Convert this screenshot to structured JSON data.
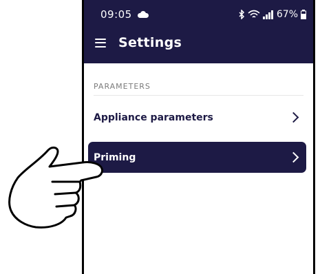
{
  "status": {
    "time": "09:05",
    "battery": "67%"
  },
  "header": {
    "title": "Settings"
  },
  "sections": [
    {
      "label": "PARAMETERS",
      "items": [
        {
          "label": "Appliance parameters"
        },
        {
          "label": "Priming"
        }
      ]
    }
  ],
  "colors": {
    "accent": "#1d1a45"
  },
  "icons": [
    "cloud-icon",
    "bluetooth-icon",
    "wifi-icon",
    "signal-icon",
    "battery-icon",
    "menu-icon",
    "chevron-right-icon",
    "pointing-hand-icon"
  ]
}
